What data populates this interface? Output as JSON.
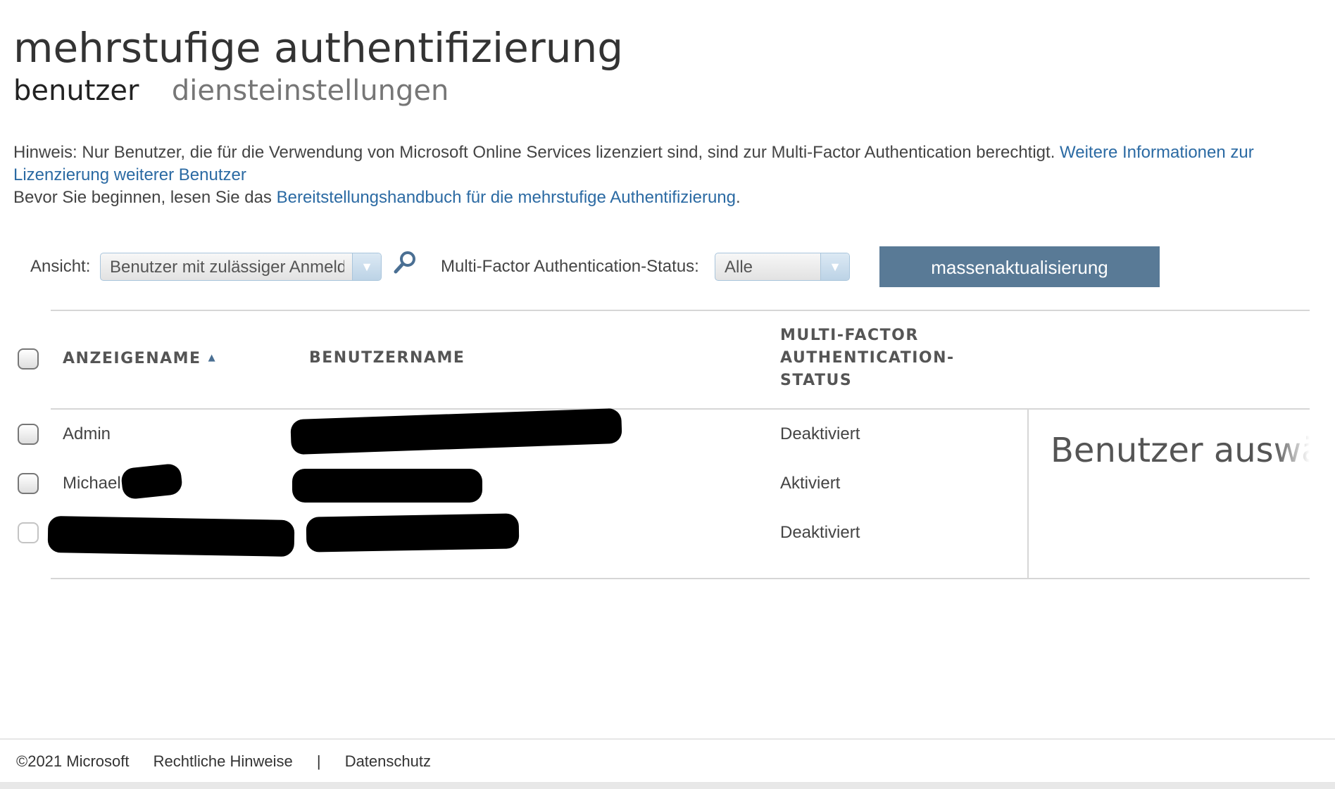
{
  "header": {
    "title": "mehrstufige authentifizierung",
    "tabs": [
      {
        "label": "benutzer",
        "active": true
      },
      {
        "label": "diensteinstellungen",
        "active": false
      }
    ]
  },
  "notice": {
    "line1_text": "Hinweis: Nur Benutzer, die für die Verwendung von Microsoft Online Services lizenziert sind, sind zur Multi-Factor Authentication berechtigt. ",
    "line1_link": "Weitere Informationen zur Lizenzierung weiterer Benutzer",
    "line2_text": "Bevor Sie beginnen, lesen Sie das ",
    "line2_link": "Bereitstellungshandbuch für die mehrstufige Authentifizierung",
    "line2_end": "."
  },
  "filters": {
    "view_label": "Ansicht:",
    "view_value": "Benutzer mit zulässiger Anmeldung",
    "search_icon": "search-icon",
    "status_label": "Multi-Factor Authentication-Status:",
    "status_value": "Alle",
    "bulk_update_label": "massenaktualisierung"
  },
  "table": {
    "columns": [
      "ANZEIGENAME",
      "BENUTZERNAME",
      "MULTI-FACTOR AUTHENTICATION-STATUS"
    ],
    "sort_icon": "sort-ascending-icon",
    "rows": [
      {
        "display_name": "Admin",
        "username": "",
        "status": "Deaktiviert"
      },
      {
        "display_name": "Michael",
        "username": "",
        "status": "Aktiviert"
      },
      {
        "display_name": "",
        "username": "",
        "status": "Deaktiviert"
      }
    ]
  },
  "detail_panel": {
    "text": "Benutzer auswählen"
  },
  "footer": {
    "copyright": "©2021 Microsoft",
    "legal": "Rechtliche Hinweise",
    "separator": "|",
    "privacy": "Datenschutz"
  },
  "colors": {
    "link": "#2b6aa3",
    "button": "#597a96",
    "redaction": "#000000"
  }
}
